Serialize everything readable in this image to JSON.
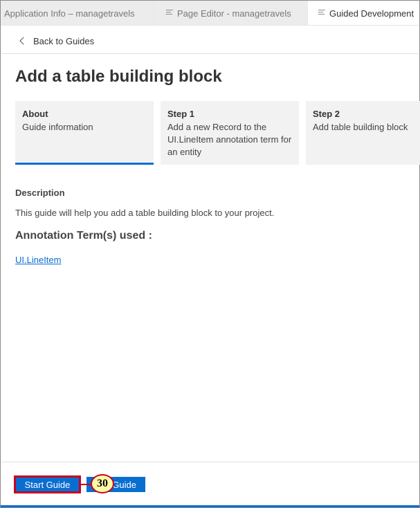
{
  "tabs": [
    {
      "label": "Application Info – managetravels",
      "icon": ""
    },
    {
      "label": "Page Editor - managetravels",
      "icon": "document-lines-icon"
    },
    {
      "label": "Guided Development",
      "icon": "document-lines-icon"
    }
  ],
  "nav": {
    "back_label": "Back to Guides"
  },
  "page": {
    "title": "Add a table building block"
  },
  "steps": [
    {
      "title": "About",
      "description": "Guide information",
      "selected": true
    },
    {
      "title": "Step 1",
      "description": "Add a new Record to the UI.LineItem annotation term for an entity"
    },
    {
      "title": "Step 2",
      "description": "Add table building block"
    }
  ],
  "description": {
    "label": "Description",
    "text": "This guide will help you add a table building block to your project."
  },
  "annotations": {
    "label": "Annotation Term(s) used :",
    "terms": [
      "UI.LineItem"
    ]
  },
  "footer": {
    "start_label": "Start Guide",
    "second_label": "Guide",
    "callout_number": "30"
  },
  "colors": {
    "accent": "#0a6ed1",
    "highlight": "#c8001e",
    "callout_bg": "#fff9a6"
  }
}
